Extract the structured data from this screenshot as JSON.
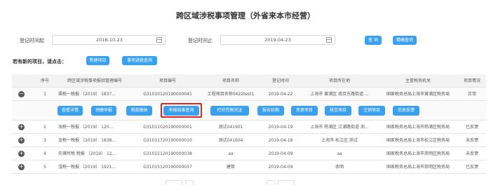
{
  "page": {
    "title": "跨区域涉税事项管理（外省来本市经营）"
  },
  "filters": {
    "start_label": "登记时间起",
    "start_value": "2018-10-23",
    "end_label": "登记时间止",
    "end_value": "2019-04-23",
    "query_label": "查 询",
    "precise_query_label": "精确查询"
  },
  "new_project": {
    "hint": "若有新的项目，请点击：",
    "new_button": "新建项目",
    "progress_button": "事项进度查询"
  },
  "table": {
    "headers": [
      "",
      "序号",
      "跨区域涉税事项报验管理编号",
      "项目编号",
      "项目名称",
      "登记时间",
      "项目所在地",
      "主管税务机关",
      "项目情况"
    ],
    "rows": [
      {
        "index": "1",
        "manage_no": "渠税一税报 〔2019〕 1837...",
        "project_no": "G31010120190000041",
        "name": "工程项目名称0422test1",
        "date": "2019-04-22",
        "location": "上海市 黄浦区 南京东路街道 ...",
        "authority": "国家税务总局上海市黄浦区税务局",
        "status": "正常",
        "toggle": "−"
      },
      {
        "index": "2",
        "manage_no": "海税一税报 〔2019〕 120...",
        "project_no": "G31011020190000001",
        "name": "测试041901",
        "date": "2019-04-19",
        "location": "上海市 杨浦区 江浦路街道 测...",
        "authority": "国家税务总局上海市杨浦区税务局",
        "status": "已反馈",
        "toggle": "+"
      },
      {
        "index": "3",
        "manage_no": "金税一税报 〔2019〕 1838...",
        "project_no": "G31011720190000010",
        "name": "测试041604",
        "date": "2019-04-16",
        "location": "上海市 松江区 测试",
        "authority": "国家税务总局上海市松江区税务局",
        "status": "未反馈",
        "toggle": "+"
      },
      {
        "index": "4",
        "manage_no": "先锋所税 税报 〔2019〕 12...",
        "project_no": "G31015120190000038",
        "name": "aa",
        "date": "2019-04-09",
        "location": "aa",
        "authority": "国家税务总局上海市崇明区税务局",
        "status": "未反馈",
        "toggle": "+"
      },
      {
        "index": "5",
        "manage_no": "湿税一税报 〔2019〕 1921...",
        "project_no": "G31015120190000037",
        "name": "建筑",
        "date": "2019-04-09",
        "location": "崇明",
        "authority": "国家税务总局上海市崇明区税务局",
        "status": "已反馈",
        "toggle": "+"
      }
    ]
  },
  "actions": {
    "buttons": [
      "查看详情",
      "预缴申报",
      "税款缴纳",
      "申报结果查询",
      "打印完税凭证",
      "报告延期",
      "变更项目",
      "核交项目",
      "注销项目",
      "信息反馈"
    ],
    "highlighted": "申报结果查询"
  },
  "colors": {
    "accent": "#3aa0f0",
    "highlight": "#e02424"
  },
  "icons": {
    "calendar": "calendar-icon",
    "collapse": "minus-circle-icon",
    "expand": "plus-circle-icon"
  }
}
